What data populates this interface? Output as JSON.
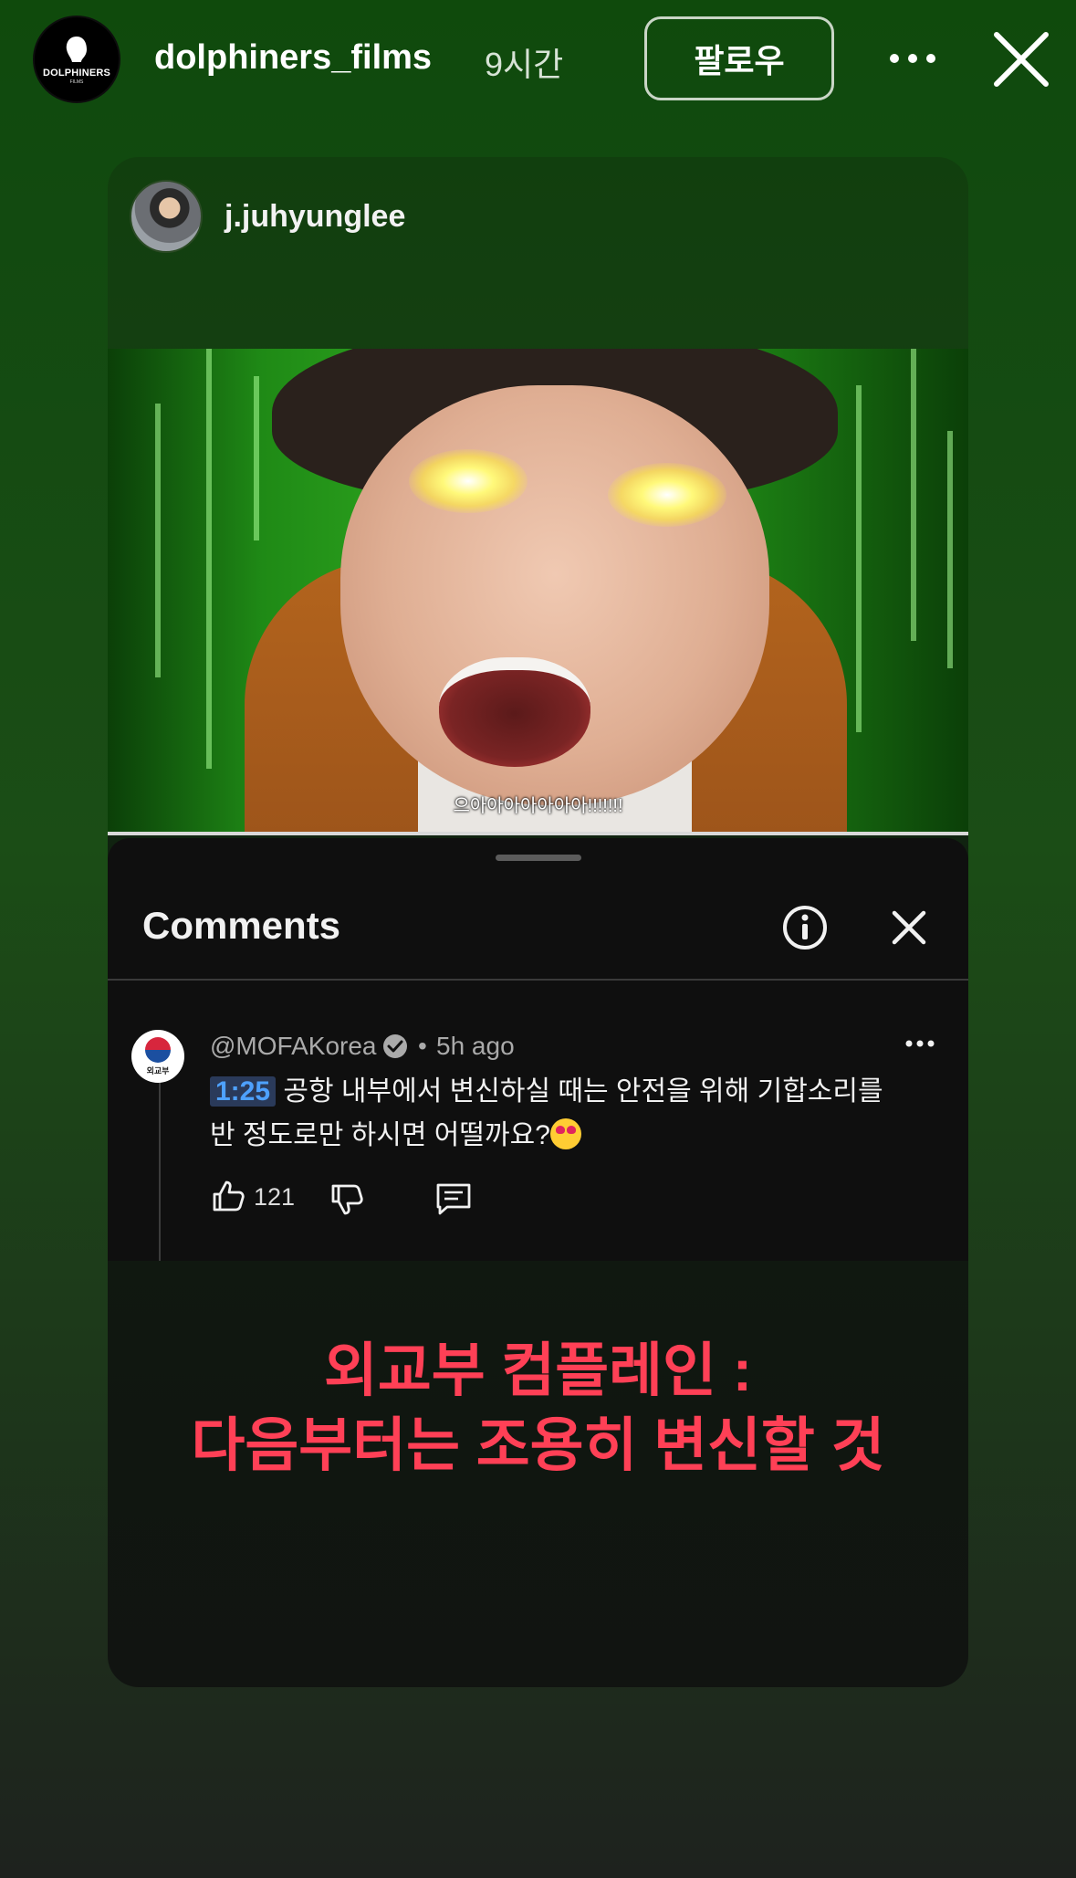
{
  "story": {
    "author": "dolphiners_films",
    "time_ago": "9시간",
    "follow_label": "팔로우",
    "avatar_logo_text": "DOLPHINERS",
    "avatar_logo_sub": "FILMS"
  },
  "shared_post": {
    "author": "j.juhyunglee",
    "video_caption": "으아아아아아아아!!!!!!!"
  },
  "comments_panel": {
    "title": "Comments",
    "comment": {
      "author_handle": "@MOFAKorea",
      "separator": "•",
      "time": "5h ago",
      "avatar_label": "외교부",
      "timestamp_link": "1:25",
      "text": " 공항 내부에서 변신하실 때는 안전을 위해 기합소리를 반 정도로만 하시면 어떨까요?",
      "like_count": "121"
    }
  },
  "overlay_caption": {
    "line1": "외교부 컴플레인 :",
    "line2": "다음부터는 조용히 변신할 것"
  },
  "colors": {
    "caption_red": "#ff4056",
    "timestamp_blue": "#4ea1ff",
    "panel_bg": "#0f0f0f"
  }
}
